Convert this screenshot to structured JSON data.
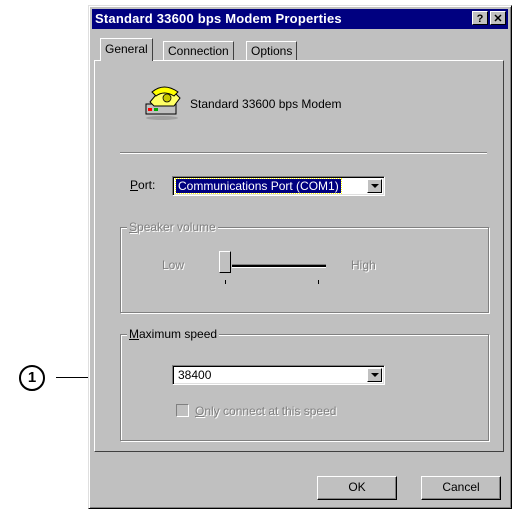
{
  "dialog": {
    "title": "Standard 33600 bps Modem Properties",
    "help_label": "?",
    "close_label": "✕"
  },
  "tabs": [
    {
      "label": "General"
    },
    {
      "label": "Connection"
    },
    {
      "label": "Options"
    }
  ],
  "general": {
    "modem_name": "Standard 33600 bps Modem",
    "port_label_prefix": "",
    "port_label_access": "P",
    "port_label_rest": "ort:",
    "port_value": "Communications Port (COM1)",
    "speaker_group_access": "S",
    "speaker_group_rest": "peaker volume",
    "volume_low": "Low",
    "volume_high": "High",
    "max_speed_access": "M",
    "max_speed_rest": "aximum speed",
    "speed_value": "38400",
    "only_connect_access": "O",
    "only_connect_rest": "nly connect at this speed"
  },
  "buttons": {
    "ok": "OK",
    "cancel": "Cancel"
  },
  "callout": {
    "number": "1"
  }
}
